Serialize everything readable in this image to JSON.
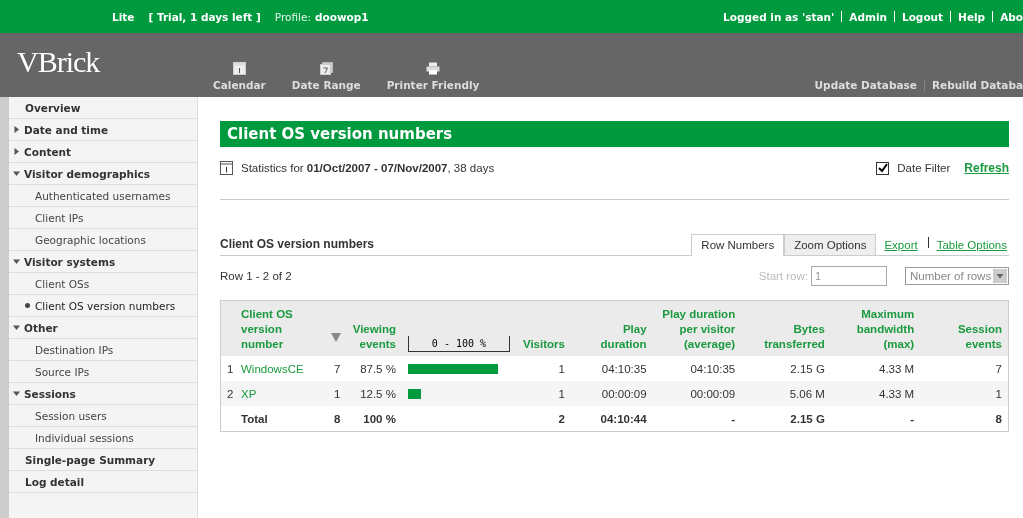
{
  "top_bar": {
    "edition": "Lite",
    "trial": "[ Trial, 1 days left ]",
    "profile_label": "Profile:",
    "profile": "doowop1",
    "logged_in": "Logged in as 'stan'",
    "links": [
      "Admin",
      "Logout",
      "Help",
      "Abo"
    ]
  },
  "header": {
    "logo": "VBrick",
    "tools": [
      {
        "label": "Calendar",
        "kind": "calendar"
      },
      {
        "label": "Date Range",
        "kind": "range"
      },
      {
        "label": "Printer Friendly",
        "kind": "printer"
      }
    ],
    "db_links": [
      "Update Database",
      "Rebuild Databa"
    ]
  },
  "sidebar": {
    "items": [
      {
        "label": "Overview",
        "kind": "top"
      },
      {
        "label": "Date and time",
        "kind": "group",
        "expanded": false
      },
      {
        "label": "Content",
        "kind": "group",
        "expanded": false
      },
      {
        "label": "Visitor demographics",
        "kind": "group",
        "expanded": true,
        "children": [
          {
            "label": "Authenticated usernames",
            "selected": false
          },
          {
            "label": "Client IPs",
            "selected": false
          },
          {
            "label": "Geographic locations",
            "selected": false
          }
        ]
      },
      {
        "label": "Visitor systems",
        "kind": "group",
        "expanded": true,
        "children": [
          {
            "label": "Client OSs",
            "selected": false
          },
          {
            "label": "Client OS version numbers",
            "selected": true
          }
        ]
      },
      {
        "label": "Other",
        "kind": "group",
        "expanded": true,
        "children": [
          {
            "label": "Destination IPs",
            "selected": false
          },
          {
            "label": "Source IPs",
            "selected": false
          }
        ]
      },
      {
        "label": "Sessions",
        "kind": "group",
        "expanded": true,
        "children": [
          {
            "label": "Session users",
            "selected": false
          },
          {
            "label": "Individual sessions",
            "selected": false
          }
        ]
      },
      {
        "label": "Single-page Summary",
        "kind": "top"
      },
      {
        "label": "Log detail",
        "kind": "top"
      }
    ]
  },
  "page_title": "Client OS version numbers",
  "stats": {
    "text": "Statistics for **01/Oct/2007 - 07/Nov/2007**, 38 days",
    "date_filter": {
      "label": "Date Filter",
      "checked": true
    },
    "refresh": "Refresh"
  },
  "report": {
    "title": "Client OS version numbers",
    "tabs": [
      {
        "label": "Row Numbers",
        "selected": true
      },
      {
        "label": "Zoom Options",
        "selected": false
      }
    ],
    "links": [
      "Export",
      "Table Options"
    ],
    "row_info": "Row 1 - 2 of 2",
    "start_row": {
      "label": "Start row:",
      "value": "1"
    },
    "rows_select": {
      "placeholder": "Number of rows"
    }
  },
  "table": {
    "columns": [
      "Client OS version number",
      "Viewing events",
      "0 - 100 %",
      "Visitors",
      "Play duration",
      "Play duration per visitor (average)",
      "Bytes transferred",
      "Maximum bandwidth (max)",
      "Session events"
    ],
    "rows": [
      {
        "index": "1",
        "name": "WindowsCE",
        "events": "7",
        "percent": "87.5 %",
        "level": 0.875,
        "visitors": "1",
        "play": "04:10:35",
        "per_visitor": "04:10:35",
        "bytes": "2.15 G",
        "bandwidth": "4.33 M",
        "sessions": "7"
      },
      {
        "index": "2",
        "name": "XP",
        "events": "1",
        "percent": "12.5 %",
        "level": 0.125,
        "visitors": "1",
        "play": "00:00:09",
        "per_visitor": "00:00:09",
        "bytes": "5.06 M",
        "bandwidth": "4.33 M",
        "sessions": "1"
      }
    ],
    "total": {
      "label": "Total",
      "events": "8",
      "percent": "100 %",
      "visitors": "2",
      "play": "04:10:44",
      "per_visitor": "-",
      "bytes": "2.15 G",
      "bandwidth": "-",
      "sessions": "8"
    }
  }
}
